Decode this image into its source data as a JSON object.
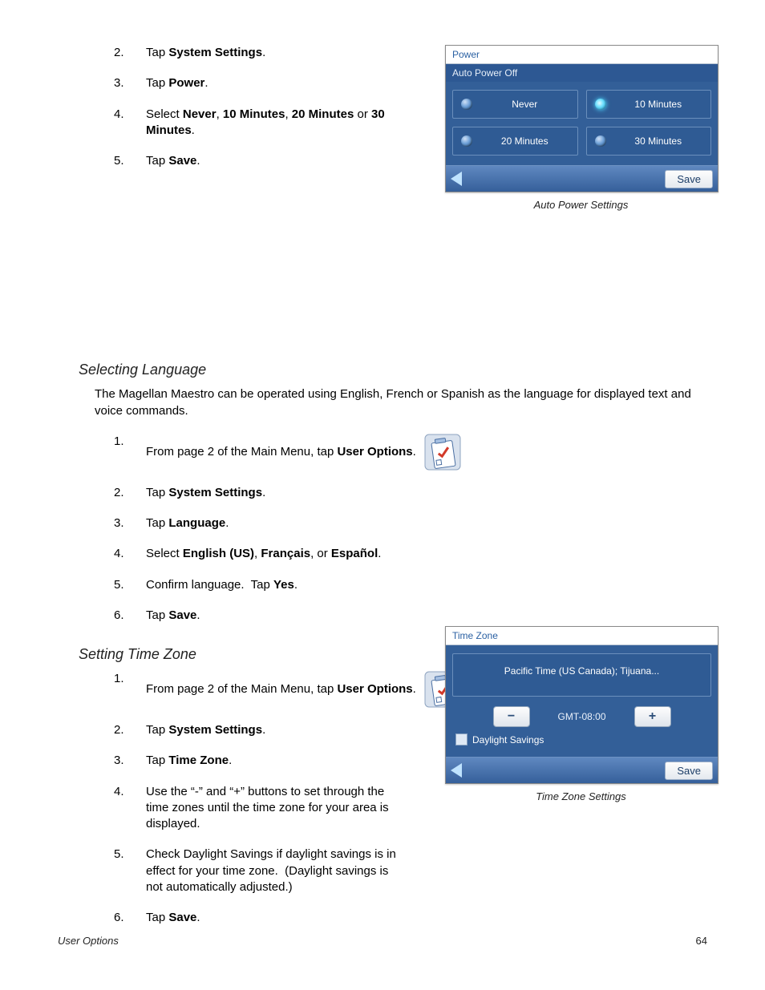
{
  "power_steps": [
    {
      "n": "2.",
      "html": "Tap <b>System Settings</b>."
    },
    {
      "n": "3.",
      "html": "Tap <b>Power</b>."
    },
    {
      "n": "4.",
      "html": "Select <b>Never</b>, <b>10 Minutes</b>, <b>20 Minutes</b> or <b>30 Minutes</b>."
    },
    {
      "n": "5.",
      "html": "Tap <b>Save</b>."
    }
  ],
  "fig_power": {
    "title": "Power",
    "subtitle": "Auto Power Off",
    "options": [
      {
        "label": "Never",
        "on": false
      },
      {
        "label": "10 Minutes",
        "on": true
      },
      {
        "label": "20 Minutes",
        "on": false
      },
      {
        "label": "30 Minutes",
        "on": false
      }
    ],
    "save": "Save",
    "caption": "Auto Power Settings"
  },
  "sec_lang": {
    "heading": "Selecting Language",
    "para": "The Magellan Maestro can be operated using English, French or Spanish as the language for displayed text and voice commands.",
    "step1_prefix": "From page 2 of the Main Menu, tap ",
    "step1_bold": "User Options",
    "step1_suffix": ".",
    "steps_rest": [
      {
        "n": "2.",
        "html": "Tap <b>System Settings</b>."
      },
      {
        "n": "3.",
        "html": "Tap <b>Language</b>."
      },
      {
        "n": "4.",
        "html": "Select <b>English (US)</b>, <b>Français</b>, or <b>Español</b>."
      },
      {
        "n": "5.",
        "html": "Confirm language.&nbsp; Tap <b>Yes</b>."
      },
      {
        "n": "6.",
        "html": "Tap <b>Save</b>."
      }
    ]
  },
  "sec_tz": {
    "heading": "Setting Time Zone",
    "step1_prefix": "From page 2 of the Main Menu, tap ",
    "step1_bold": "User Options",
    "step1_suffix": ".",
    "steps_rest": [
      {
        "n": "2.",
        "html": "Tap <b>System Settings</b>."
      },
      {
        "n": "3.",
        "html": "Tap <b>Time Zone</b>."
      },
      {
        "n": "4.",
        "html": "Use the “-” and “+” buttons to set through the time zones until the time zone for your area is displayed."
      },
      {
        "n": "5.",
        "html": "Check Daylight Savings if daylight savings is in effect for your time zone.&nbsp; (Daylight savings is not automatically adjusted.)"
      },
      {
        "n": "6.",
        "html": "Tap <b>Save</b>."
      }
    ]
  },
  "fig_tz": {
    "title": "Time Zone",
    "zone_name": "Pacific Time (US  Canada); Tijuana...",
    "gmt": "GMT-08:00",
    "dls_label": "Daylight Savings",
    "save": "Save",
    "caption": "Time Zone Settings"
  },
  "footer": {
    "left": "User Options",
    "right": "64"
  }
}
